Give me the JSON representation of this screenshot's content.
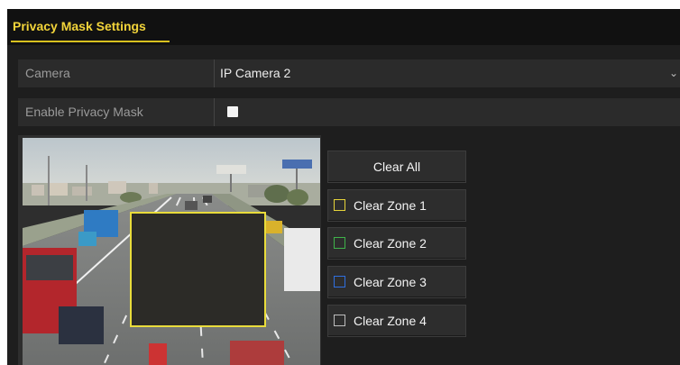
{
  "tab": {
    "label": "Privacy Mask Settings"
  },
  "camera_row": {
    "label": "Camera",
    "value": "IP Camera 2"
  },
  "enable_row": {
    "label": "Enable Privacy Mask",
    "checked": true
  },
  "buttons": {
    "clear_all": "Clear All",
    "zones": [
      {
        "label": "Clear Zone 1",
        "color": "#e6d43a"
      },
      {
        "label": "Clear Zone 2",
        "color": "#3fb34a"
      },
      {
        "label": "Clear Zone 3",
        "color": "#2f6fe0"
      },
      {
        "label": "Clear Zone 4",
        "color": "#bdbdbd"
      }
    ]
  },
  "colors": {
    "accent": "#f2d43a",
    "panel_bg": "#1e1e1e",
    "mask_border": "#e9dc3b"
  }
}
